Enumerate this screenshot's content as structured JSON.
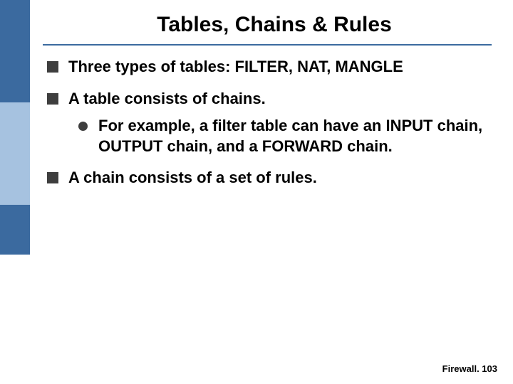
{
  "title": "Tables, Chains & Rules",
  "bullets": {
    "b1": "Three types of tables: FILTER, NAT, MANGLE",
    "b2": "A table consists of chains.",
    "b2_sub1": "For example, a filter table can have an INPUT chain, OUTPUT chain, and a FORWARD chain.",
    "b3": "A chain consists of a set of rules."
  },
  "footer": "Firewall. 103",
  "colors": {
    "accent": "#3b6a9f",
    "accent_light": "#a6c2e0"
  }
}
